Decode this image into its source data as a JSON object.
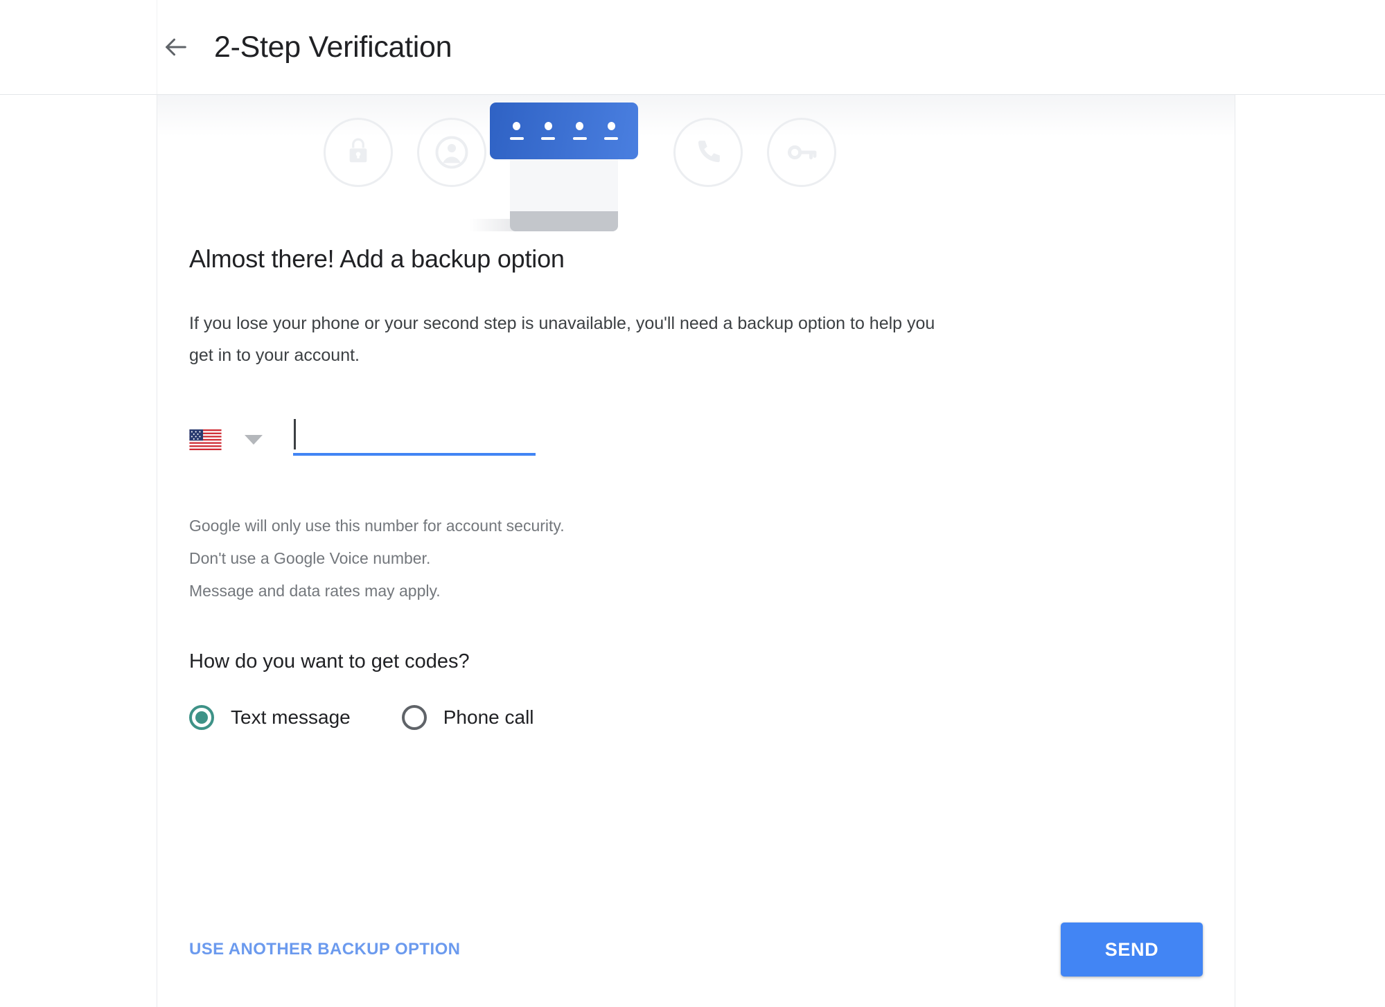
{
  "header": {
    "back_icon": "back-arrow-icon",
    "title": "2-Step Verification"
  },
  "illustration": {
    "icons": [
      {
        "name": "lock-icon",
        "state": "faded"
      },
      {
        "name": "person-icon",
        "state": "faded"
      },
      {
        "name": "pin-code-card",
        "state": "highlighted"
      },
      {
        "name": "phone-icon",
        "state": "faded"
      },
      {
        "name": "key-icon",
        "state": "faded"
      }
    ],
    "pin_dots": 4,
    "accent_color": "#3f6fd1"
  },
  "main": {
    "heading": "Almost there! Add a backup option",
    "intro": "If you lose your phone or your second step is unavailable, you'll need a backup option to help you get in to your account.",
    "phone": {
      "country_flag": "us-flag-icon",
      "country_code_label": "United States",
      "dropdown_icon": "chevron-down-icon",
      "value": "",
      "placeholder": "",
      "underline_color": "#4285f4",
      "focused": true
    },
    "helper_lines": [
      "Google will only use this number for account security.",
      "Don't use a Google Voice number.",
      "Message and data rates may apply."
    ],
    "codes_question": "How do you want to get codes?",
    "code_options": [
      {
        "label": "Text message",
        "selected": true
      },
      {
        "label": "Phone call",
        "selected": false
      }
    ],
    "selected_color": "#3e9287"
  },
  "actions": {
    "secondary_label": "USE ANOTHER BACKUP OPTION",
    "secondary_color": "#6b9aee",
    "primary_label": "SEND",
    "primary_color": "#4285f4"
  }
}
